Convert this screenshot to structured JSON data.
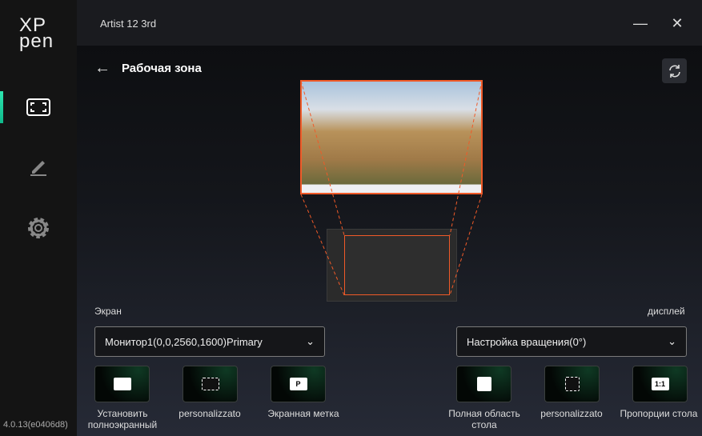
{
  "app": {
    "title": "Artist 12 3rd",
    "logo": "XP pen",
    "version": "4.0.13(e0406d8)"
  },
  "sidebar": {
    "items": [
      {
        "name": "work-area",
        "icon": "fullscreen-icon",
        "active": true
      },
      {
        "name": "pen",
        "icon": "pen-icon"
      },
      {
        "name": "settings",
        "icon": "gear-icon"
      }
    ]
  },
  "page": {
    "title": "Рабочая зона"
  },
  "screen_section": {
    "label": "Экран",
    "monitor": "Монитор1(0,0,2560,1600)Primary",
    "options": [
      {
        "label": "Установить полноэкранный"
      },
      {
        "label": "personalizzato"
      },
      {
        "label": "Экранная метка",
        "glyph": "P"
      }
    ]
  },
  "tablet_section": {
    "label": "дисплей",
    "rotation": "Настройка вращения(0°)",
    "options": [
      {
        "label": "Полная область стола"
      },
      {
        "label": "personalizzato"
      },
      {
        "label": "Пропорции стола",
        "glyph": "1:1"
      }
    ]
  },
  "colors": {
    "accent": "#2de6b0",
    "mapping": "#f05a28"
  }
}
